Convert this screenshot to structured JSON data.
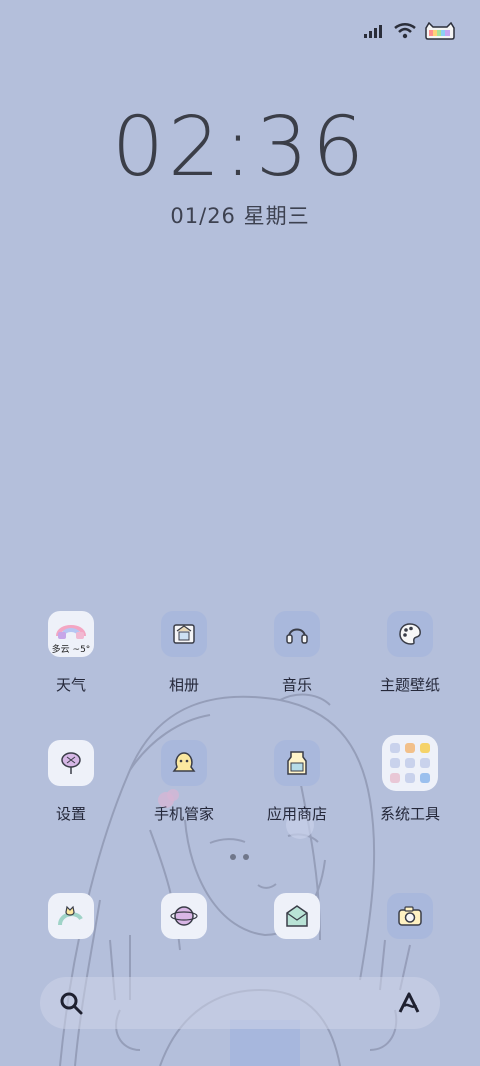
{
  "status_bar": {
    "signal_icon": "signal-bars-icon",
    "wifi_icon": "wifi-icon",
    "battery_icon": "cat-battery-icon"
  },
  "clock": {
    "time": "02:36",
    "date": "01/26 星期三"
  },
  "weather_widget": {
    "text": "多云 ~5°"
  },
  "apps": [
    {
      "label": "天气",
      "icon": "rainbow-weather-icon"
    },
    {
      "label": "相册",
      "icon": "photo-album-icon"
    },
    {
      "label": "音乐",
      "icon": "headphones-icon"
    },
    {
      "label": "主题壁纸",
      "icon": "palette-icon"
    },
    {
      "label": "设置",
      "icon": "pin-settings-icon"
    },
    {
      "label": "手机管家",
      "icon": "ghost-manager-icon"
    },
    {
      "label": "应用商店",
      "icon": "milk-carton-store-icon"
    },
    {
      "label": "系统工具",
      "icon": "tools-folder-icon"
    }
  ],
  "dock_row_icons": [
    "cat-rainbow-icon",
    "planet-icon",
    "envelope-icon",
    "camera-icon"
  ],
  "dock": {
    "search_icon": "search-icon",
    "assistant_icon": "assistant-icon"
  },
  "colors": {
    "background": "#b4bfdb",
    "tile_light": "#eef1f9",
    "tile_blue": "#a9b8dc"
  }
}
